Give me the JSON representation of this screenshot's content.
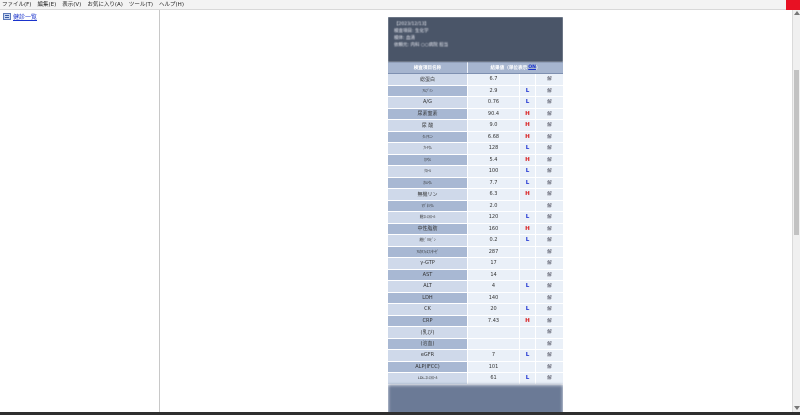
{
  "menu": [
    "ファイル(F)",
    "編集(E)",
    "表示(V)",
    "お気に入り(A)",
    "ツール(T)",
    "ヘルプ(H)"
  ],
  "sidebar": {
    "link_label": "健診一覧"
  },
  "header": {
    "lines": [
      "【2023/12/13】",
      "検査項目: 生化学",
      "検体: 血清",
      "依頼元: 内科 ○○病院 担当"
    ]
  },
  "table": {
    "col_name": "検査項目名称",
    "col_value": "結果値（単位表示",
    "col_toggle": "ON",
    "col_value_suffix": "）",
    "rows": [
      {
        "name": "総蛋白",
        "value": "6.7",
        "flag": "",
        "link": "解",
        "small": false
      },
      {
        "name": "ｱﾙﾌﾞﾐﾝ",
        "value": "2.9",
        "flag": "L",
        "link": "解",
        "small": true
      },
      {
        "name": "A/G",
        "value": "0.76",
        "flag": "L",
        "link": "解",
        "small": false
      },
      {
        "name": "尿素窒素",
        "value": "90.4",
        "flag": "H",
        "link": "解",
        "small": false
      },
      {
        "name": "尿 酸",
        "value": "9.0",
        "flag": "H",
        "link": "解",
        "small": false
      },
      {
        "name": "ｸﾚｱﾁﾆﾝ",
        "value": "6.68",
        "flag": "H",
        "link": "解",
        "small": true
      },
      {
        "name": "ﾅﾄﾘｳﾑ",
        "value": "128",
        "flag": "L",
        "link": "解",
        "small": true
      },
      {
        "name": "ｶﾘｳﾑ",
        "value": "5.4",
        "flag": "H",
        "link": "解",
        "small": true
      },
      {
        "name": "ｸﾛｰﾙ",
        "value": "100",
        "flag": "L",
        "link": "解",
        "small": true
      },
      {
        "name": "ｶﾙｼｳﾑ",
        "value": "7.7",
        "flag": "L",
        "link": "解",
        "small": true
      },
      {
        "name": "無機リン",
        "value": "6.3",
        "flag": "H",
        "link": "解",
        "small": false
      },
      {
        "name": "ﾏｸﾞﾈｼｳﾑ",
        "value": "2.0",
        "flag": "",
        "link": "解",
        "small": true
      },
      {
        "name": "総ｺﾚｽﾃﾛｰﾙ",
        "value": "120",
        "flag": "L",
        "link": "解",
        "small": true
      },
      {
        "name": "中性脂肪",
        "value": "160",
        "flag": "H",
        "link": "解",
        "small": false
      },
      {
        "name": "総ﾋﾞﾘﾙﾋﾞﾝ",
        "value": "0.2",
        "flag": "L",
        "link": "解",
        "small": true
      },
      {
        "name": "ｱﾙｶﾘﾌｫｽﾌｧﾀｰｾﾞ",
        "value": "287",
        "flag": "",
        "link": "解",
        "small": true
      },
      {
        "name": "γ-GTP",
        "value": "17",
        "flag": "",
        "link": "解",
        "small": false
      },
      {
        "name": "AST",
        "value": "14",
        "flag": "",
        "link": "解",
        "small": false
      },
      {
        "name": "ALT",
        "value": "4",
        "flag": "L",
        "link": "解",
        "small": false
      },
      {
        "name": "LDH",
        "value": "140",
        "flag": "",
        "link": "解",
        "small": false
      },
      {
        "name": "CK",
        "value": "20",
        "flag": "L",
        "link": "解",
        "small": false
      },
      {
        "name": "CRP",
        "value": "7.43",
        "flag": "H",
        "link": "解",
        "small": false
      },
      {
        "name": "(乳び)",
        "value": "",
        "flag": "",
        "link": "解",
        "small": false
      },
      {
        "name": "(溶血)",
        "value": "",
        "flag": "",
        "link": "解",
        "small": false
      },
      {
        "name": "eGFR",
        "value": "7",
        "flag": "L",
        "link": "解",
        "small": false
      },
      {
        "name": "ALP(IFCC)",
        "value": "101",
        "flag": "",
        "link": "解",
        "small": false
      },
      {
        "name": "LDL-ｺﾚｽﾃﾛｰﾙ",
        "value": "61",
        "flag": "L",
        "link": "解",
        "small": true
      }
    ]
  },
  "colors": {
    "high": "#d81b1b",
    "low": "#1a2fd1",
    "header_bg": "#4a5568"
  }
}
